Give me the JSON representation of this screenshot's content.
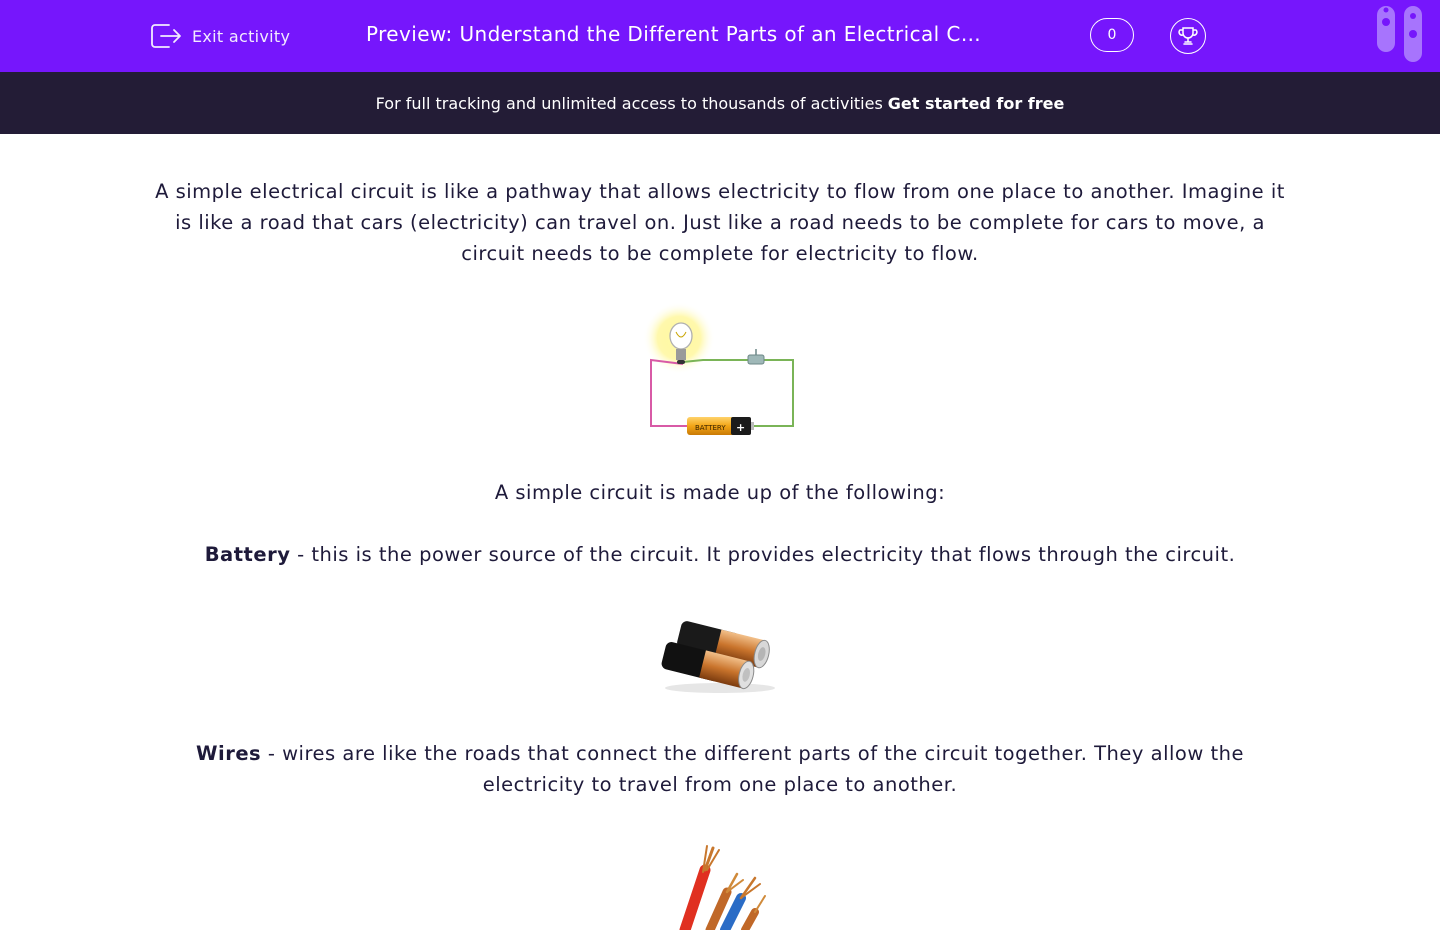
{
  "header": {
    "exit_label": "Exit activity",
    "title": "Preview: Understand the Different Parts of an Electrical Circuit",
    "score": "0",
    "exit_icon": "exit-icon",
    "trophy_icon": "trophy-icon"
  },
  "banner": {
    "text": "For full tracking and unlimited access to thousands of activities",
    "link": "Get started for free"
  },
  "content": {
    "intro": "A simple electrical circuit is like a pathway that allows electricity to flow from one place to another. Imagine it is like a road that cars (electricity) can travel on. Just like a road needs to be complete for cars to move, a circuit needs to be complete for electricity to flow.",
    "list_heading": "A simple circuit is made up of the following:",
    "battery_term": "Battery",
    "battery_desc": " - this is the power source of the circuit.  It provides electricity that flows through the circuit.",
    "battery_label": "BATTERY",
    "battery_plus": "+",
    "wires_term": "Wires",
    "wires_desc": " - wires are like the roads that connect the different parts of the circuit together. They allow the electricity to travel from one place to another."
  },
  "colors": {
    "header_bg": "#7616fc",
    "banner_bg": "#231c36",
    "text": "#1e1a3a"
  }
}
